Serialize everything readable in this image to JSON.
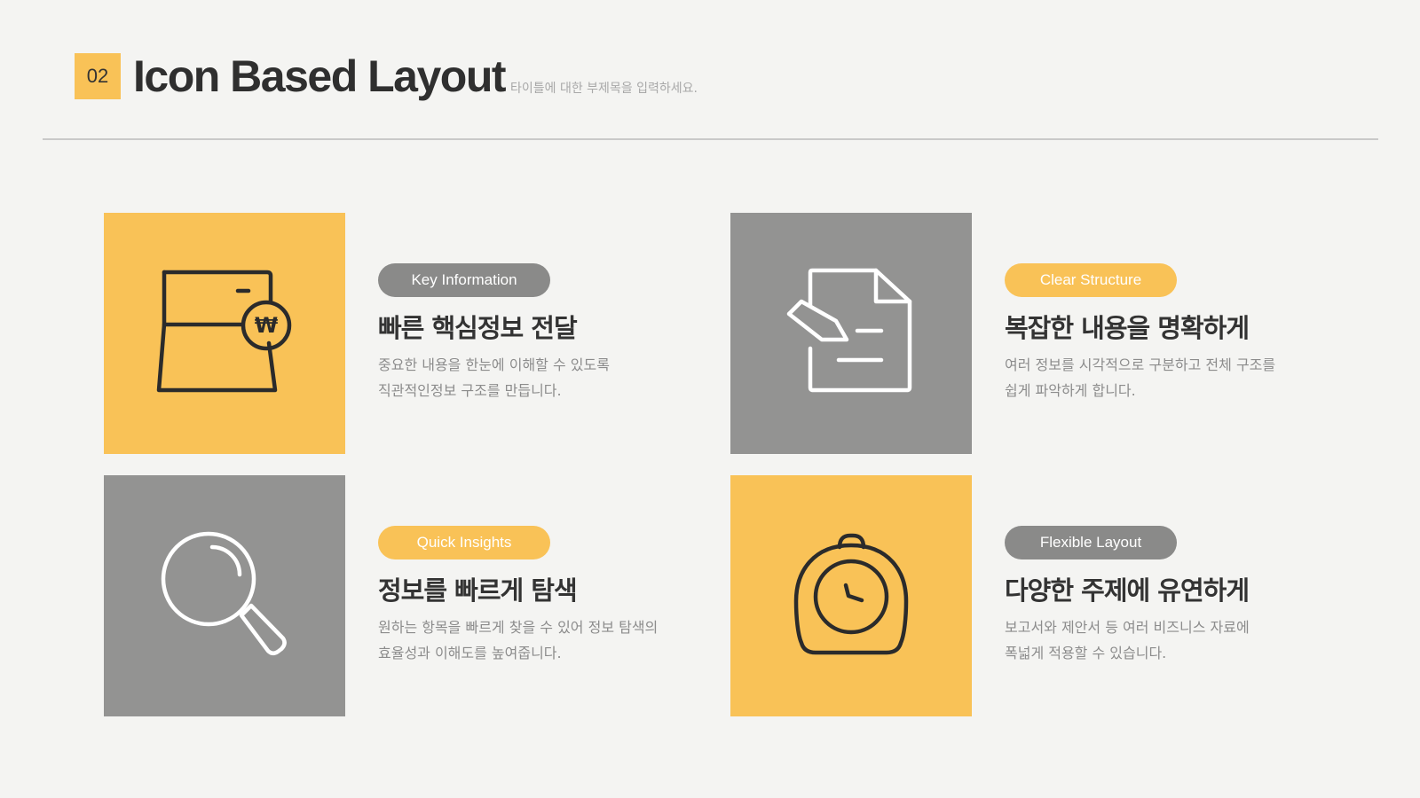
{
  "header": {
    "number": "02",
    "title": "Icon Based Layout",
    "subtitle": "타이틀에 대한 부제목을 입력하세요."
  },
  "cards": [
    {
      "icon": "wallet-won-icon",
      "tile_color": "#f9c257",
      "badge": "Key Information",
      "badge_color": "#8a8a89",
      "title": "빠른 핵심정보 전달",
      "desc_line1": "중요한 내용을 한눈에 이해할 수 있도록",
      "desc_line2": "직관적인정보 구조를 만듭니다."
    },
    {
      "icon": "document-edit-icon",
      "tile_color": "#939392",
      "badge": "Clear Structure",
      "badge_color": "#f9c257",
      "title": "복잡한 내용을 명확하게",
      "desc_line1": "여러 정보를 시각적으로 구분하고 전체 구조를",
      "desc_line2": "쉽게 파악하게 합니다."
    },
    {
      "icon": "magnifier-icon",
      "tile_color": "#939392",
      "badge": "Quick Insights",
      "badge_color": "#f9c257",
      "title": "정보를 빠르게 탐색",
      "desc_line1": "원하는 항목을 빠르게 찾을 수 있어 정보 탐색의",
      "desc_line2": "효율성과 이해도를 높여줍니다."
    },
    {
      "icon": "alarm-clock-icon",
      "tile_color": "#f9c257",
      "badge": "Flexible Layout",
      "badge_color": "#8a8a89",
      "title": "다양한 주제에 유연하게",
      "desc_line1": "보고서와 제안서 등 여러 비즈니스 자료에",
      "desc_line2": "폭넓게 적용할 수 있습니다."
    }
  ]
}
